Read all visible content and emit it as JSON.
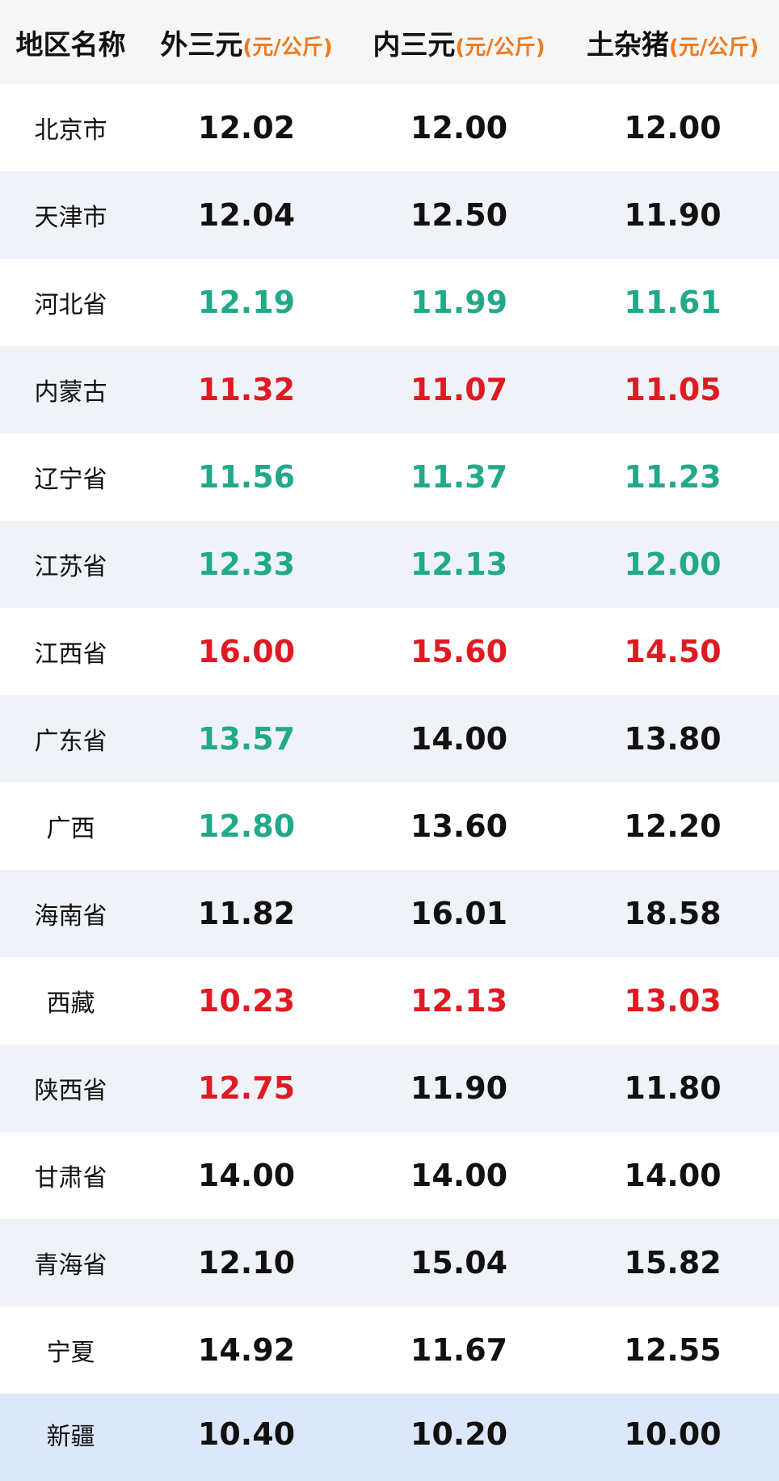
{
  "header": {
    "region": "地区名称",
    "col1": "外三元",
    "col2": "内三元",
    "col3": "土杂猪",
    "unit": "(元/公斤)"
  },
  "colors": {
    "up": "#e01a22",
    "down": "#22a98a",
    "flat": "#111111",
    "unit": "#f07a1e"
  },
  "rows": [
    {
      "region": "北京市",
      "v1": "12.02",
      "v2": "12.00",
      "v3": "12.00",
      "t1": "flat",
      "t2": "flat",
      "t3": "flat"
    },
    {
      "region": "天津市",
      "v1": "12.04",
      "v2": "12.50",
      "v3": "11.90",
      "t1": "flat",
      "t2": "flat",
      "t3": "flat"
    },
    {
      "region": "河北省",
      "v1": "12.19",
      "v2": "11.99",
      "v3": "11.61",
      "t1": "down",
      "t2": "down",
      "t3": "down"
    },
    {
      "region": "内蒙古",
      "v1": "11.32",
      "v2": "11.07",
      "v3": "11.05",
      "t1": "up",
      "t2": "up",
      "t3": "up"
    },
    {
      "region": "辽宁省",
      "v1": "11.56",
      "v2": "11.37",
      "v3": "11.23",
      "t1": "down",
      "t2": "down",
      "t3": "down"
    },
    {
      "region": "江苏省",
      "v1": "12.33",
      "v2": "12.13",
      "v3": "12.00",
      "t1": "down",
      "t2": "down",
      "t3": "down"
    },
    {
      "region": "江西省",
      "v1": "16.00",
      "v2": "15.60",
      "v3": "14.50",
      "t1": "up",
      "t2": "up",
      "t3": "up"
    },
    {
      "region": "广东省",
      "v1": "13.57",
      "v2": "14.00",
      "v3": "13.80",
      "t1": "down",
      "t2": "flat",
      "t3": "flat"
    },
    {
      "region": "广西",
      "v1": "12.80",
      "v2": "13.60",
      "v3": "12.20",
      "t1": "down",
      "t2": "flat",
      "t3": "flat"
    },
    {
      "region": "海南省",
      "v1": "11.82",
      "v2": "16.01",
      "v3": "18.58",
      "t1": "flat",
      "t2": "flat",
      "t3": "flat"
    },
    {
      "region": "西藏",
      "v1": "10.23",
      "v2": "12.13",
      "v3": "13.03",
      "t1": "up",
      "t2": "up",
      "t3": "up"
    },
    {
      "region": "陕西省",
      "v1": "12.75",
      "v2": "11.90",
      "v3": "11.80",
      "t1": "up",
      "t2": "flat",
      "t3": "flat"
    },
    {
      "region": "甘肃省",
      "v1": "14.00",
      "v2": "14.00",
      "v3": "14.00",
      "t1": "flat",
      "t2": "flat",
      "t3": "flat"
    },
    {
      "region": "青海省",
      "v1": "12.10",
      "v2": "15.04",
      "v3": "15.82",
      "t1": "flat",
      "t2": "flat",
      "t3": "flat"
    },
    {
      "region": "宁夏",
      "v1": "14.92",
      "v2": "11.67",
      "v3": "12.55",
      "t1": "flat",
      "t2": "flat",
      "t3": "flat"
    },
    {
      "region": "新疆",
      "v1": "10.40",
      "v2": "10.20",
      "v3": "10.00",
      "t1": "flat",
      "t2": "flat",
      "t3": "flat"
    }
  ]
}
